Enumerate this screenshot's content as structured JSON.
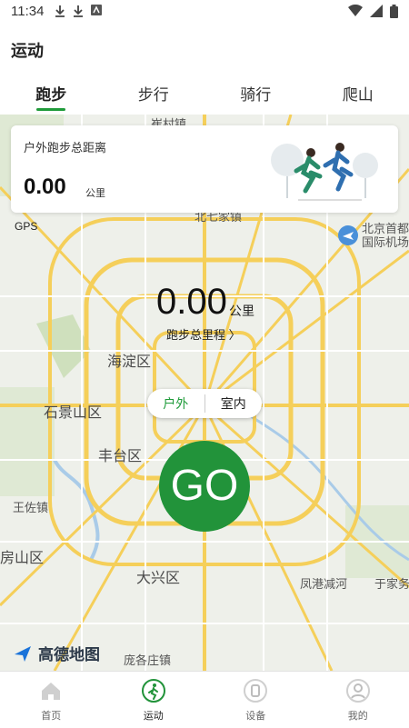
{
  "status": {
    "time": "11:34"
  },
  "header": {
    "title": "运动"
  },
  "tabs": [
    {
      "label": "跑步",
      "active": true
    },
    {
      "label": "步行"
    },
    {
      "label": "骑行"
    },
    {
      "label": "爬山"
    }
  ],
  "card": {
    "label": "户外跑步总距离",
    "value": "0.00",
    "unit": "公里"
  },
  "map": {
    "gps": "GPS",
    "center_value": "0.00",
    "center_unit": "公里",
    "center_link": "跑步总里程 〉",
    "mode_outdoor": "户外",
    "mode_indoor": "室内",
    "go_label": "GO",
    "provider": "高德地图",
    "labels": [
      "海淀区",
      "石景山区",
      "丰台区",
      "大兴区",
      "房山区",
      "王佐镇",
      "北京首都国际机场",
      "凤港减河",
      "于家务",
      "庞各庄镇",
      "北七家镇",
      "崔村镇"
    ]
  },
  "colors": {
    "accent": "#1f9b3a",
    "go": "#22933a"
  },
  "nav": [
    {
      "label": "首页",
      "icon": "home-icon"
    },
    {
      "label": "运动",
      "icon": "run-icon",
      "active": true
    },
    {
      "label": "设备",
      "icon": "watch-icon"
    },
    {
      "label": "我的",
      "icon": "user-icon"
    }
  ]
}
